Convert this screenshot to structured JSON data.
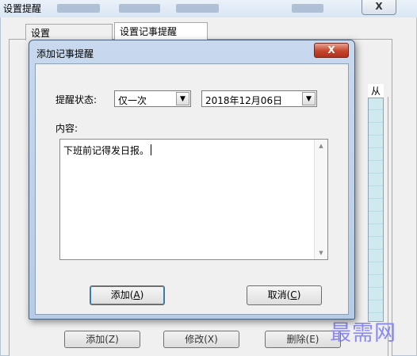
{
  "outer_window": {
    "title": "设置提醒",
    "close_label": "X",
    "tabs": [
      "设置",
      "设置记事提醒"
    ],
    "list_header": "从",
    "buttons": [
      "添加(Z)",
      "修改(X)",
      "删除(E)"
    ]
  },
  "watermark": "最需网",
  "dialog": {
    "title": "添加记事提醒",
    "close_label": "X",
    "status_label": "提醒状态:",
    "status_value": "仅一次",
    "date_value": "2018年12月06日",
    "content_label": "内容:",
    "content_text": "下班前记得发日报。",
    "add_button": {
      "text": "添加(",
      "key": "A",
      "end": ")"
    },
    "cancel_button": {
      "text": "取消(",
      "key": "C",
      "end": ")"
    }
  },
  "icons": {
    "dropdown": "chevron-down-icon",
    "scroll_up": "scroll-up-icon",
    "scroll_down": "scroll-down-icon"
  }
}
